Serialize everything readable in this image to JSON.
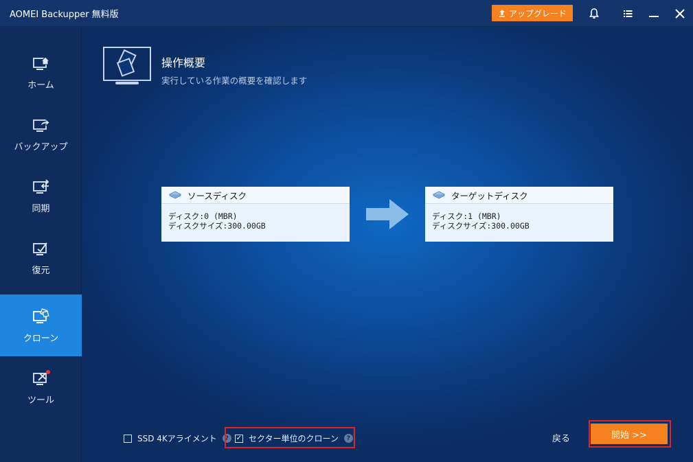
{
  "window": {
    "title": "AOMEI Backupper 無料版",
    "upgrade_label": "アップグレード",
    "icons": [
      "bell-icon",
      "menu-icon",
      "minimize-icon",
      "close-icon"
    ]
  },
  "sidebar": {
    "items": [
      {
        "label": "ホーム",
        "icon": "home-icon",
        "active": false
      },
      {
        "label": "バックアップ",
        "icon": "backup-icon",
        "active": false
      },
      {
        "label": "同期",
        "icon": "sync-icon",
        "active": false
      },
      {
        "label": "復元",
        "icon": "restore-icon",
        "active": false
      },
      {
        "label": "クローン",
        "icon": "clone-icon",
        "active": true
      },
      {
        "label": "ツール",
        "icon": "tools-icon",
        "active": false
      }
    ]
  },
  "header": {
    "title": "操作概要",
    "subtitle": "実行している作業の概要を確認します"
  },
  "source": {
    "title": "ソースディスク",
    "disk": "ディスク:0 (MBR)",
    "size": "ディスクサイズ:300.00GB"
  },
  "target": {
    "title": "ターゲットディスク",
    "disk": "ディスク:1 (MBR)",
    "size": "ディスクサイズ:300.00GB"
  },
  "options": {
    "ssd_label": "SSD 4Kアライメント",
    "ssd_checked": false,
    "sector_label": "セクター単位のクローン",
    "sector_checked": true
  },
  "actions": {
    "back_label": "戻る",
    "start_label": "開始 >>"
  },
  "colors": {
    "accent_orange": "#f5821f",
    "active_blue": "#1f86e0",
    "highlight_red": "#e02424"
  }
}
